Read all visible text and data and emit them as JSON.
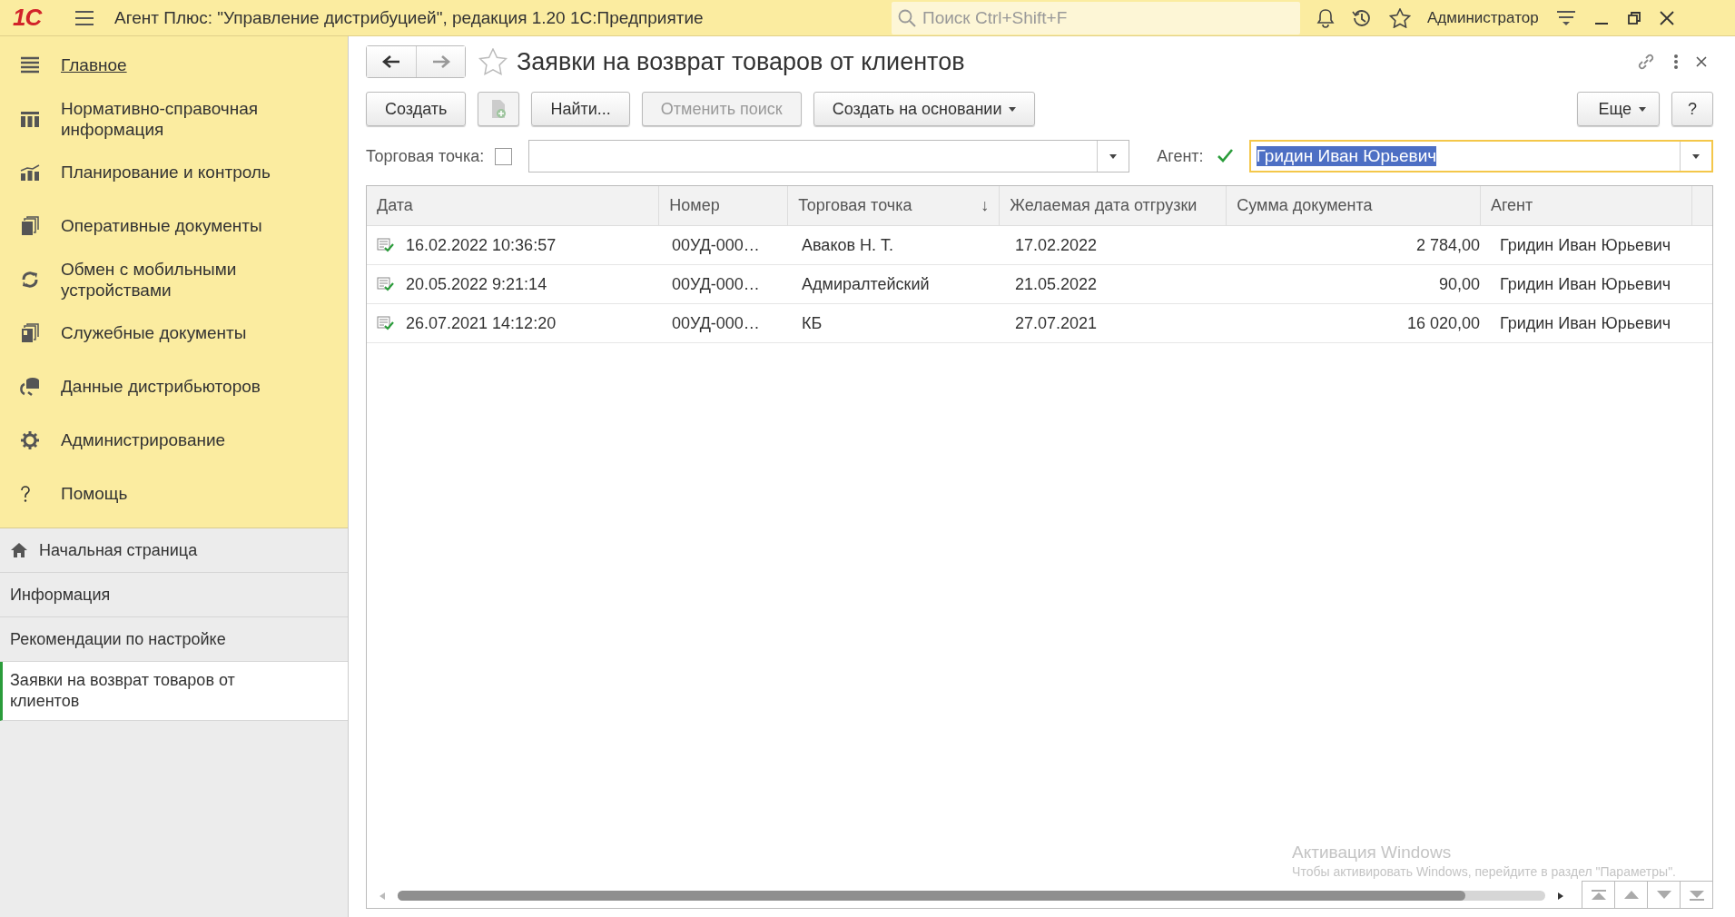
{
  "app": {
    "logo": "1С",
    "title": "Агент Плюс: \"Управление дистрибуцией\", редакция 1.20 1С:Предприятие",
    "search_placeholder": "Поиск Ctrl+Shift+F",
    "user": "Администратор"
  },
  "sections": [
    {
      "kind": "menu",
      "label": "Главное",
      "selected": true
    },
    {
      "kind": "catalog",
      "label": "Нормативно-справочная информация",
      "selected": false
    },
    {
      "kind": "chart",
      "label": "Планирование и контроль",
      "selected": false
    },
    {
      "kind": "docs",
      "label": "Оперативные документы",
      "selected": false
    },
    {
      "kind": "sync",
      "label": "Обмен с мобильными устройствами",
      "selected": false
    },
    {
      "kind": "service",
      "label": "Служебные документы",
      "selected": false
    },
    {
      "kind": "data",
      "label": "Данные дистрибьюторов",
      "selected": false
    },
    {
      "kind": "gear",
      "label": "Администрирование",
      "selected": false
    },
    {
      "kind": "help",
      "label": "Помощь",
      "selected": false
    }
  ],
  "open_windows": [
    {
      "kind": "home",
      "label": "Начальная страница",
      "selected": false
    },
    {
      "kind": "plain",
      "label": "Информация",
      "selected": false
    },
    {
      "kind": "plain",
      "label": "Рекомендации по настройке",
      "selected": false
    },
    {
      "kind": "plain",
      "label": "Заявки на возврат товаров от клиентов",
      "selected": true
    }
  ],
  "form": {
    "title": "Заявки на возврат товаров от клиентов",
    "buttons": [
      {
        "kind": "text",
        "label": "Создать",
        "disabled": false
      },
      {
        "kind": "icon",
        "disabled": true
      },
      {
        "kind": "text",
        "label": "Найти...",
        "disabled": false
      },
      {
        "kind": "text",
        "label": "Отменить поиск",
        "disabled": true
      },
      {
        "kind": "dropdown",
        "label": "Создать на основании",
        "disabled": false
      }
    ],
    "right_buttons": [
      {
        "kind": "dropdown",
        "label": "Еще",
        "disabled": false
      },
      {
        "kind": "text",
        "label": "?",
        "disabled": false
      }
    ],
    "filters": [
      {
        "label": "Торговая точка:",
        "checked": false
      },
      {
        "label": "Агент:",
        "checked": true,
        "value": "Гридин Иван Юрьевич"
      }
    ]
  },
  "table": {
    "columns": [
      {
        "label": "Дата"
      },
      {
        "label": "Номер"
      },
      {
        "label": "Торговая точка",
        "sort_mark": "↓"
      },
      {
        "label": "Желаемая дата отгрузки"
      },
      {
        "label": "Сумма документа"
      },
      {
        "label": "Агент"
      }
    ],
    "rows": [
      {
        "cells": [
          "16.02.2022 10:36:57",
          "00УД-000…",
          "Аваков Н. Т.",
          "17.02.2022",
          "2 784,00",
          "Гридин Иван Юрьевич"
        ]
      },
      {
        "cells": [
          "20.05.2022 9:21:14",
          "00УД-000…",
          "Адмиралтейский",
          "21.05.2022",
          "90,00",
          "Гридин Иван Юрьевич"
        ]
      },
      {
        "cells": [
          "26.07.2021 14:12:20",
          "00УД-000…",
          "КБ",
          "27.07.2021",
          "16 020,00",
          "Гридин Иван Юрьевич"
        ]
      }
    ]
  },
  "activation": {
    "title": "Активация Windows",
    "text": "Чтобы активировать Windows, перейдите в раздел \"Параметры\"."
  }
}
